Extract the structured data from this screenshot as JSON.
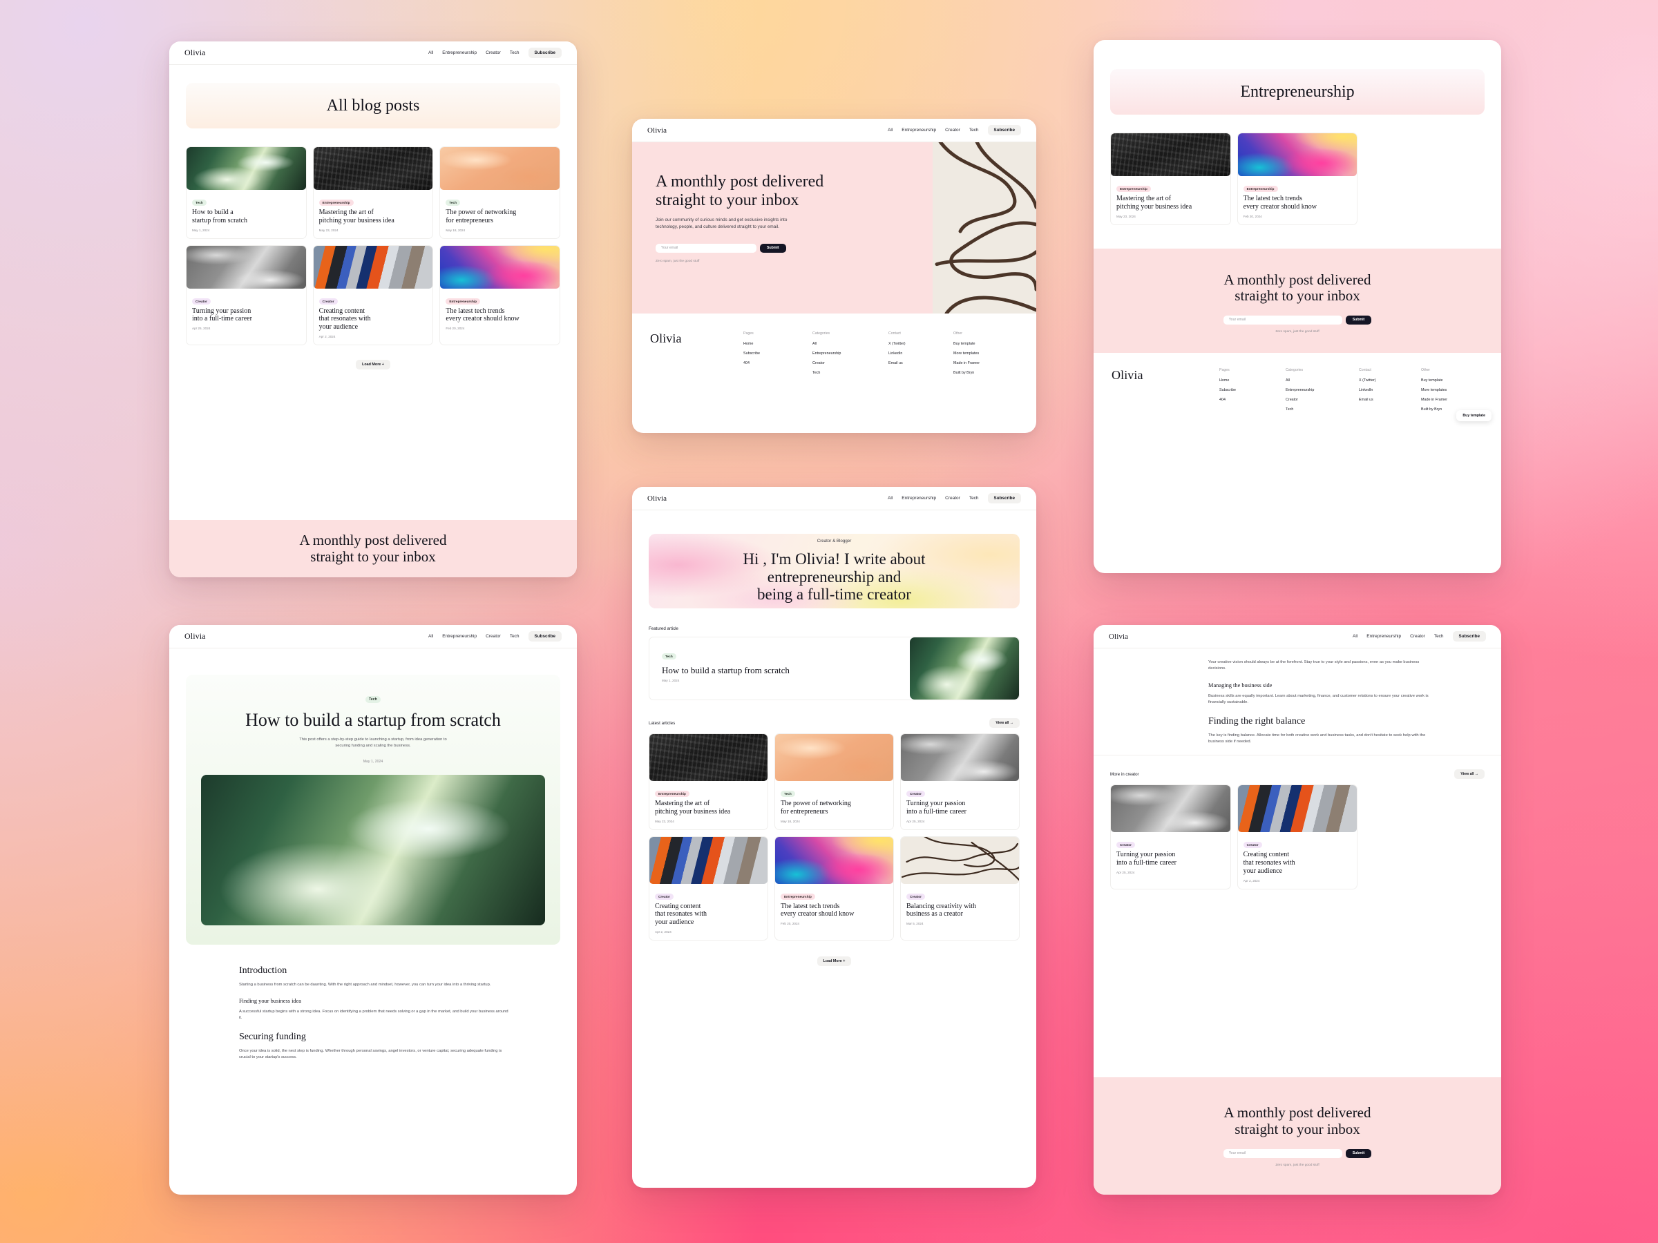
{
  "brand": "Olivia",
  "nav": {
    "links": [
      "All",
      "Entrepreneurship",
      "Creator",
      "Tech"
    ],
    "subscribe": "Subscribe"
  },
  "colors": {
    "ink": "#14141c",
    "submit_bg": "#151625",
    "newsletter_bg": "#fce0e0",
    "tag_tech": "#e4f2e6",
    "tag_entrepreneurship": "#fbdfe4",
    "tag_creator": "#f2e4f7"
  },
  "panel_blog_index": {
    "hero_title": "All blog posts",
    "load_more": "Load More +",
    "posts": [
      {
        "tag": "Tech",
        "tag_class": "tech",
        "title": "How to build a\nstartup from scratch",
        "date": "May 1, 2024",
        "img": "img-green"
      },
      {
        "tag": "Entrepreneurship",
        "tag_class": "entrepreneurship",
        "title": "Mastering the art of\npitching your business idea",
        "date": "May 23, 2024",
        "img": "img-charcoal"
      },
      {
        "tag": "Tech",
        "tag_class": "tech",
        "title": "The power of networking\nfor entrepreneurs",
        "date": "May 18, 2024",
        "img": "img-peach"
      },
      {
        "tag": "Creator",
        "tag_class": "creator",
        "title": "Turning your passion\ninto a full-time career",
        "date": "Apr 25, 2024",
        "img": "img-gray"
      },
      {
        "tag": "Creator",
        "tag_class": "creator",
        "title": "Creating content\nthat resonates with\nyour audience",
        "date": "Apr 2, 2024",
        "img": "img-fabric"
      },
      {
        "tag": "Entrepreneurship",
        "tag_class": "entrepreneurship",
        "title": "The latest tech trends\nevery creator should know",
        "date": "Feb 20, 2024",
        "img": "img-rainbow"
      }
    ],
    "newsletter_title": "A monthly post delivered\nstraight to your inbox"
  },
  "panel_subscribe": {
    "title": "A monthly post delivered\nstraight to your inbox",
    "body": "Join our community of curious minds and get exclusive insights into technology, people, and culture delivered straight to your email.",
    "email_placeholder": "Your email",
    "submit": "Submit",
    "micro": "Zero spam, just the good stuff"
  },
  "footer": {
    "brand": "Olivia",
    "columns": [
      {
        "heading": "Pages",
        "links": [
          "Home",
          "Subscribe",
          "404"
        ]
      },
      {
        "heading": "Categories",
        "links": [
          "All",
          "Entrepreneurship",
          "Creator",
          "Tech"
        ]
      },
      {
        "heading": "Contact",
        "links": [
          "X (Twitter)",
          "LinkedIn",
          "Email us"
        ]
      },
      {
        "heading": "Other",
        "links": [
          "Buy template",
          "More templates",
          "Made in Framer",
          "Built by Bryn"
        ]
      }
    ],
    "buy_template": "Buy template"
  },
  "panel_category": {
    "hero_title": "Entrepreneurship",
    "posts": [
      {
        "tag": "Entrepreneurship",
        "tag_class": "entrepreneurship",
        "title": "Mastering the art of\npitching your business idea",
        "date": "May 23, 2024",
        "img": "img-charcoal"
      },
      {
        "tag": "Entrepreneurship",
        "tag_class": "entrepreneurship",
        "title": "The latest tech trends\nevery creator should know",
        "date": "Feb 20, 2024",
        "img": "img-rainbow"
      }
    ],
    "newsletter_title": "A monthly post delivered\nstraight to your inbox",
    "email_placeholder": "Your email",
    "submit": "Submit",
    "micro": "Zero spam, just the good stuff"
  },
  "panel_article": {
    "tag": "Tech",
    "title": "How to build a startup from scratch",
    "subtitle": "This post offers a step-by-step guide to launching a startup, from idea generation to securing funding and scaling the business.",
    "date": "May 1, 2024",
    "sections": [
      {
        "level": "h2",
        "heading": "Introduction",
        "body": "Starting a business from scratch can be daunting. With the right approach and mindset, however, you can turn your idea into a thriving startup."
      },
      {
        "level": "h3",
        "heading": "Finding your business idea",
        "body": "A successful startup begins with a strong idea. Focus on identifying a problem that needs solving or a gap in the market, and build your business around it."
      },
      {
        "level": "h2",
        "heading": "Securing funding",
        "body": "Once your idea is solid, the next step is funding. Whether through personal savings, angel investors, or venture capital, securing adequate funding is crucial to your startup's success."
      }
    ]
  },
  "panel_home": {
    "eyebrow": "Creator & Blogger",
    "hero_title": "Hi , I'm Olivia! I write about\nentrepreneurship and\nbeing a full-time creator",
    "featured_label": "Featured article",
    "featured": {
      "tag": "Tech",
      "tag_class": "tech",
      "title": "How to build a\nstartup from scratch",
      "date": "May 1, 2024",
      "img": "img-green"
    },
    "latest_label": "Latest articles",
    "view_all": "View all →",
    "load_more": "Load More +",
    "posts": [
      {
        "tag": "Entrepreneurship",
        "tag_class": "entrepreneurship",
        "title": "Mastering the art of\npitching your business idea",
        "date": "May 23, 2024",
        "img": "img-charcoal"
      },
      {
        "tag": "Tech",
        "tag_class": "tech",
        "title": "The power of networking\nfor entrepreneurs",
        "date": "May 18, 2024",
        "img": "img-peach"
      },
      {
        "tag": "Creator",
        "tag_class": "creator",
        "title": "Turning your passion\ninto a full-time career",
        "date": "Apr 25, 2024",
        "img": "img-gray"
      },
      {
        "tag": "Creator",
        "tag_class": "creator",
        "title": "Creating content\nthat resonates with\nyour audience",
        "date": "Apr 2, 2024",
        "img": "img-fabric"
      },
      {
        "tag": "Entrepreneurship",
        "tag_class": "entrepreneurship",
        "title": "The latest tech trends\nevery creator should know",
        "date": "Feb 20, 2024",
        "img": "img-rainbow"
      },
      {
        "tag": "Creator",
        "tag_class": "creator",
        "title": "Balancing creativity with\nbusiness as a creator",
        "date": "Mar 5, 2024",
        "img": "img-lines"
      }
    ]
  },
  "panel_article2": {
    "sections": [
      {
        "level": "p",
        "heading": "",
        "body": "Your creative vision should always be at the forefront. Stay true to your style and passions, even as you make business decisions."
      },
      {
        "level": "h3",
        "heading": "Managing the business side",
        "body": "Business skills are equally important. Learn about marketing, finance, and customer relations to ensure your creative work is financially sustainable."
      },
      {
        "level": "h2",
        "heading": "Finding the right balance",
        "body": "The key is finding balance. Allocate time for both creative work and business tasks, and don't hesitate to seek help with the business side if needed."
      }
    ],
    "more_label": "More in creator",
    "view_all": "View all →",
    "posts": [
      {
        "tag": "Creator",
        "tag_class": "creator",
        "title": "Turning your passion\ninto a full-time career",
        "date": "Apr 25, 2024",
        "img": "img-gray"
      },
      {
        "tag": "Creator",
        "tag_class": "creator",
        "title": "Creating content\nthat resonates with\nyour audience",
        "date": "Apr 2, 2024",
        "img": "img-fabric"
      }
    ],
    "newsletter_title": "A monthly post delivered\nstraight to your inbox",
    "email_placeholder": "Your email",
    "submit": "Submit",
    "micro": "Zero spam, just the good stuff"
  }
}
